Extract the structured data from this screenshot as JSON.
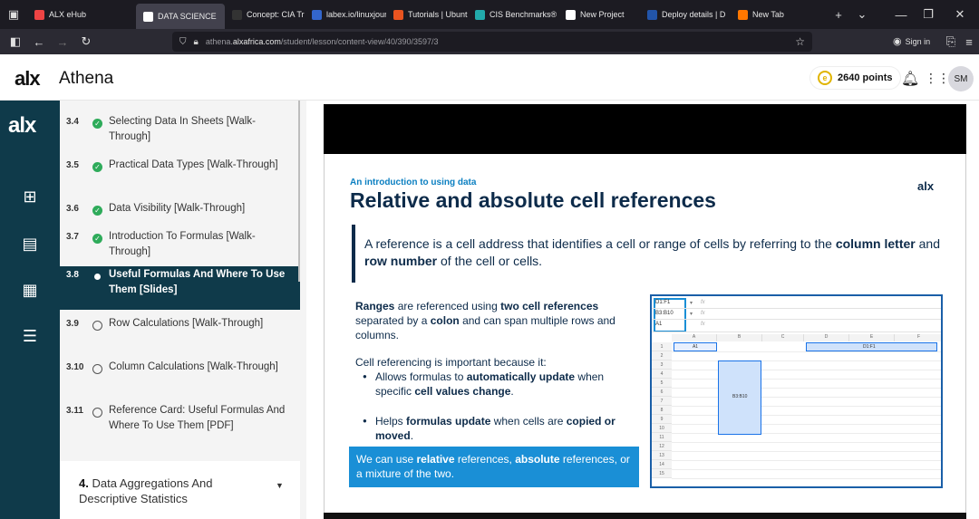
{
  "browser": {
    "tabs": [
      {
        "label": "ALX eHub",
        "color": "#e44"
      },
      {
        "label": "DATA SCIENCE",
        "color": "#fff",
        "active": true
      },
      {
        "label": "Concept: CIA Tria",
        "color": "#333"
      },
      {
        "label": "labex.io/linuxjour",
        "color": "#36c"
      },
      {
        "label": "Tutorials | Ubuntu",
        "color": "#e95420"
      },
      {
        "label": "CIS Benchmarks®",
        "color": "#2aa"
      },
      {
        "label": "New Project",
        "color": "#fff"
      },
      {
        "label": "Deploy details | D",
        "color": "#25a"
      },
      {
        "label": "New Tab",
        "color": "#f70"
      }
    ],
    "url_prefix": "athena.",
    "url_host": "alxafrica.com",
    "url_path": "/student/lesson/content-view/40/390/3597/3",
    "sign_in": "Sign in"
  },
  "app": {
    "logo": "alx",
    "name": "Athena",
    "points": "2640 points",
    "avatar": "SM"
  },
  "lessons": [
    {
      "num": "3.4",
      "title": "Selecting Data In Sheets [Walk-Through]",
      "status": "done"
    },
    {
      "num": "3.5",
      "title": "Practical Data Types [Walk-Through]",
      "status": "done"
    },
    {
      "num": "3.6",
      "title": "Data Visibility [Walk-Through]",
      "status": "done"
    },
    {
      "num": "3.7",
      "title": "Introduction To Formulas [Walk-Through]",
      "status": "done"
    },
    {
      "num": "3.8",
      "title": "Useful Formulas And Where To Use Them [Slides]",
      "status": "current"
    },
    {
      "num": "3.9",
      "title": "Row Calculations [Walk-Through]",
      "status": "todo"
    },
    {
      "num": "3.10",
      "title": "Column Calculations [Walk-Through]",
      "status": "todo"
    },
    {
      "num": "3.11",
      "title": "Reference Card: Useful Formulas And Where To Use Them [PDF]",
      "status": "todo"
    }
  ],
  "section": {
    "num": "4.",
    "title": "Data Aggregations And Descriptive Statistics"
  },
  "slide": {
    "kicker": "An introduction to using data",
    "title": "Relative and absolute cell references",
    "logo": "alx",
    "quote_a": "A reference is a cell address that identifies a cell or range of cells by referring to the ",
    "quote_b": "column letter",
    "quote_c": " and ",
    "quote_d": "row number",
    "quote_e": " of the cell or cells.",
    "p1_a": "Ranges",
    "p1_b": " are referenced using ",
    "p1_c": "two cell references",
    "p1_d": " separated by a ",
    "p1_e": "colon",
    "p1_f": " and can span multiple rows and columns.",
    "p2": "Cell referencing is important because it:",
    "b1_a": "Allows formulas to ",
    "b1_b": "automatically update",
    "b1_c": " when specific ",
    "b1_d": "cell values change",
    "b1_e": ".",
    "b2_a": "Helps ",
    "b2_b": "formulas update",
    "b2_c": " when cells are ",
    "b2_d": "copied or moved",
    "b2_e": ".",
    "callout_a": "We can use ",
    "callout_b": "relative",
    "callout_c": " references, ",
    "callout_d": "absolute",
    "callout_e": " references, or a mixture of the two."
  },
  "sheet": {
    "names": [
      "D1:F1",
      "B3:B10",
      "A1"
    ],
    "fx": "fx",
    "cols": [
      "A",
      "B",
      "C",
      "D",
      "E",
      "F"
    ],
    "rows": [
      "1",
      "2",
      "3",
      "4",
      "5",
      "6",
      "7",
      "8",
      "9",
      "10",
      "11",
      "12",
      "13",
      "14",
      "15"
    ],
    "a1_label": "A1",
    "d_label": "D1:F1",
    "b_label": "B3:B10"
  }
}
